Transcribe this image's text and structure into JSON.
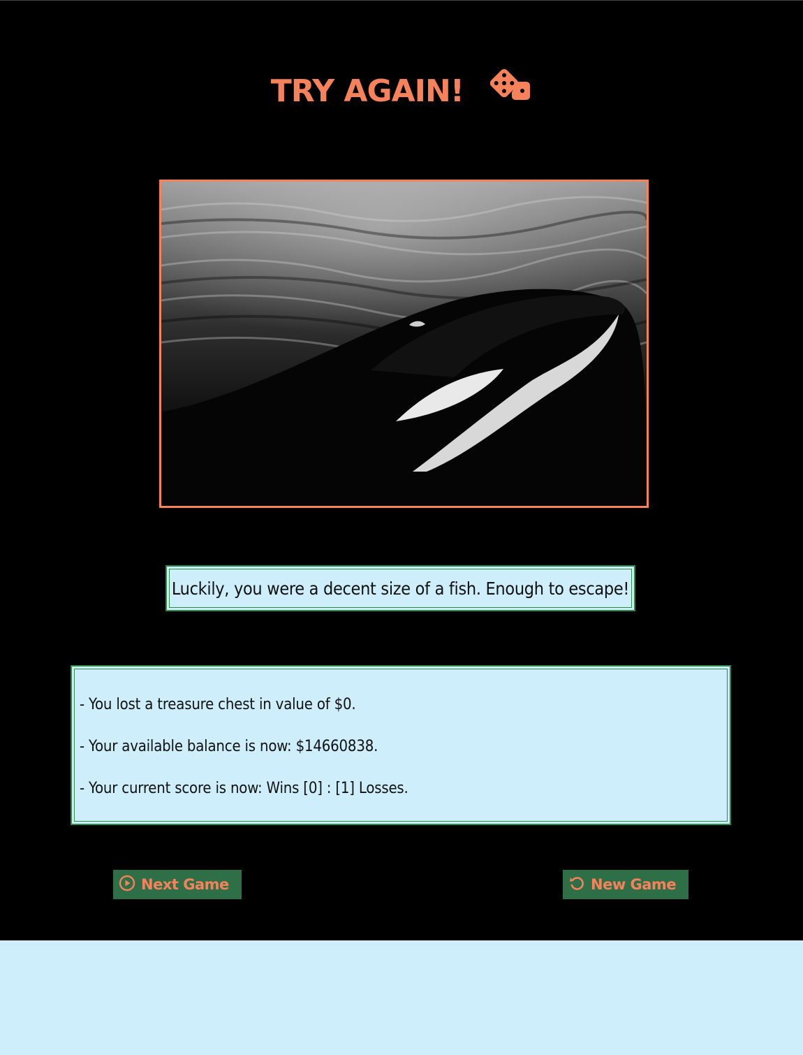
{
  "title": "TRY AGAIN!",
  "icons": {
    "title": "dice-icon",
    "next": "play-circle-icon",
    "new": "restart-icon"
  },
  "colors": {
    "accent": "#f5825a",
    "background": "#000000",
    "panel": "#cdeefa",
    "panel_border": "#2e8b47",
    "button_bg": "#2f6f47"
  },
  "message": "Luckily, you were a decent size of a fish. Enough to escape!",
  "stats": [
    "- You lost a treasure chest in value of $0.",
    "- Your available balance is now: $14660838.",
    "- Your current score is now: Wins [0] : [1] Losses."
  ],
  "buttons": {
    "next": "Next Game",
    "new": "New Game"
  }
}
